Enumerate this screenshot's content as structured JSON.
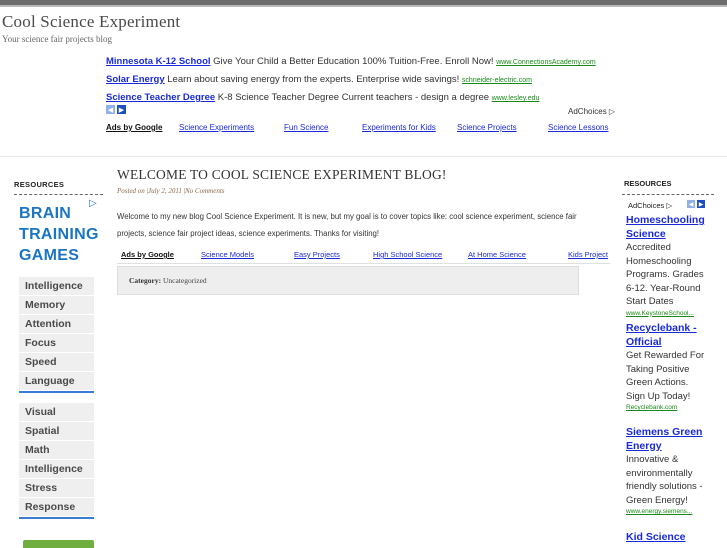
{
  "site": {
    "title": "Cool Science Experiment",
    "tagline": "Your science fair projects blog"
  },
  "top_ads": [
    {
      "title": "Minnesota K-12 School",
      "text": "Give Your Child a Better Education 100% Tuition-Free. Enroll Now!",
      "url": "www.ConnectionsAcademy.com"
    },
    {
      "title": "Solar Energy",
      "text": "Learn about saving energy from the experts. Enterprise wide savings!",
      "url": "schneider-electric.com"
    },
    {
      "title": "Science Teacher Degree",
      "text": "K-8 Science Teacher Degree Current teachers - design a degree",
      "url": "www.lesley.edu"
    }
  ],
  "adchoices_label": "AdChoices",
  "ads_by_google": "Ads by Google",
  "top_ad_links": [
    "Science Experiments",
    "Fun Science",
    "Experiments for Kids",
    "Science Projects",
    "Science Lessons"
  ],
  "left_sidebar": {
    "heading": "RESOURCES",
    "brain_lines": [
      "BRAIN",
      "TRAINING",
      "GAMES"
    ],
    "skills_a": [
      "Intelligence",
      "Memory",
      "Attention",
      "Focus",
      "Speed",
      "Language"
    ],
    "skills_b": [
      "Visual",
      "Spatial",
      "Math",
      "Intelligence",
      "Stress",
      "Response"
    ]
  },
  "post": {
    "title": "WELCOME TO COOL SCIENCE EXPERIMENT BLOG!",
    "meta_prefix": "Posted on",
    "date": "July 2, 2011",
    "comments": "No Comments",
    "body": "Welcome to my new blog Cool Science Experiment. It is new, but my goal is to cover topics like: cool science experiment, science fair projects, science fair project ideas, science experiments. Thanks for visiting!",
    "ad_links": [
      "Science Models",
      "Easy Projects",
      "High School Science",
      "At Home Science",
      "Kids Project"
    ],
    "category_label": "Category:",
    "category": "Uncategorized"
  },
  "right_sidebar": {
    "heading": "RESOURCES",
    "ads": [
      {
        "title": "Homeschooling Science",
        "text": "Accredited Homeschooling Programs. Grades 6-12. Year-Round Start Dates",
        "url": "www.KeystoneSchool..."
      },
      {
        "title": "Recyclebank - Official",
        "text": "Get Rewarded For Taking Positive Green Actions. Sign Up Today!",
        "url": "Recyclebank.com"
      },
      {
        "title": "Siemens Green Energy",
        "text": "Innovative & environmentally friendly solutions - Green Energy!",
        "url": "www.energy.siemens..."
      },
      {
        "title": "Kid Science",
        "text": "",
        "url": ""
      }
    ]
  },
  "colors": {
    "link": "#1a2ad8",
    "url_green": "#1a8a1a",
    "brain_blue": "#1b75c2",
    "topbar": "#6d6d6d"
  }
}
